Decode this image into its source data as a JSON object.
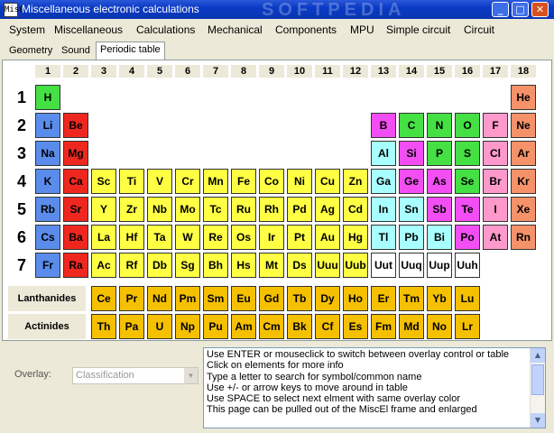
{
  "window": {
    "title": "Miscellaneous electronic calculations",
    "watermark": "SOFTPEDIA",
    "app_icon": "MisC",
    "min_glyph": "_",
    "max_glyph": "□",
    "close_glyph": "✕"
  },
  "menu": [
    "System",
    "Miscellaneous",
    "Calculations",
    "Mechanical",
    "Components",
    "MPU",
    "Simple circuit",
    "Circuit"
  ],
  "tabs": [
    {
      "label": "Geometry",
      "active": false
    },
    {
      "label": "Sound",
      "active": false
    },
    {
      "label": "Periodic table",
      "active": true
    }
  ],
  "colors": {
    "alkali": "#5a8cec",
    "alkaline_earth": "#f0271f",
    "transition": "#ffff44",
    "post_transition": "#a8ffff",
    "metalloid": "#f34ef3",
    "nonmetal": "#44e044",
    "halogen": "#ff99cc",
    "noble_gas": "#f5926a",
    "lanthanide": "#f5c000",
    "actinide": "#f5c000",
    "unknown": "#ffffff"
  },
  "groups": [
    "1",
    "2",
    "3",
    "4",
    "5",
    "6",
    "7",
    "8",
    "9",
    "10",
    "11",
    "12",
    "13",
    "14",
    "15",
    "16",
    "17",
    "18"
  ],
  "periods": [
    "1",
    "2",
    "3",
    "4",
    "5",
    "6",
    "7"
  ],
  "elements": [
    {
      "s": "H",
      "g": 1,
      "p": 1,
      "c": "nonmetal"
    },
    {
      "s": "He",
      "g": 18,
      "p": 1,
      "c": "noble_gas"
    },
    {
      "s": "Li",
      "g": 1,
      "p": 2,
      "c": "alkali"
    },
    {
      "s": "Be",
      "g": 2,
      "p": 2,
      "c": "alkaline_earth"
    },
    {
      "s": "B",
      "g": 13,
      "p": 2,
      "c": "metalloid"
    },
    {
      "s": "C",
      "g": 14,
      "p": 2,
      "c": "nonmetal"
    },
    {
      "s": "N",
      "g": 15,
      "p": 2,
      "c": "nonmetal"
    },
    {
      "s": "O",
      "g": 16,
      "p": 2,
      "c": "nonmetal"
    },
    {
      "s": "F",
      "g": 17,
      "p": 2,
      "c": "halogen"
    },
    {
      "s": "Ne",
      "g": 18,
      "p": 2,
      "c": "noble_gas"
    },
    {
      "s": "Na",
      "g": 1,
      "p": 3,
      "c": "alkali"
    },
    {
      "s": "Mg",
      "g": 2,
      "p": 3,
      "c": "alkaline_earth"
    },
    {
      "s": "Al",
      "g": 13,
      "p": 3,
      "c": "post_transition"
    },
    {
      "s": "Si",
      "g": 14,
      "p": 3,
      "c": "metalloid"
    },
    {
      "s": "P",
      "g": 15,
      "p": 3,
      "c": "nonmetal"
    },
    {
      "s": "S",
      "g": 16,
      "p": 3,
      "c": "nonmetal"
    },
    {
      "s": "Cl",
      "g": 17,
      "p": 3,
      "c": "halogen"
    },
    {
      "s": "Ar",
      "g": 18,
      "p": 3,
      "c": "noble_gas"
    },
    {
      "s": "K",
      "g": 1,
      "p": 4,
      "c": "alkali"
    },
    {
      "s": "Ca",
      "g": 2,
      "p": 4,
      "c": "alkaline_earth"
    },
    {
      "s": "Sc",
      "g": 3,
      "p": 4,
      "c": "transition"
    },
    {
      "s": "Ti",
      "g": 4,
      "p": 4,
      "c": "transition"
    },
    {
      "s": "V",
      "g": 5,
      "p": 4,
      "c": "transition"
    },
    {
      "s": "Cr",
      "g": 6,
      "p": 4,
      "c": "transition"
    },
    {
      "s": "Mn",
      "g": 7,
      "p": 4,
      "c": "transition"
    },
    {
      "s": "Fe",
      "g": 8,
      "p": 4,
      "c": "transition"
    },
    {
      "s": "Co",
      "g": 9,
      "p": 4,
      "c": "transition"
    },
    {
      "s": "Ni",
      "g": 10,
      "p": 4,
      "c": "transition"
    },
    {
      "s": "Cu",
      "g": 11,
      "p": 4,
      "c": "transition"
    },
    {
      "s": "Zn",
      "g": 12,
      "p": 4,
      "c": "transition"
    },
    {
      "s": "Ga",
      "g": 13,
      "p": 4,
      "c": "post_transition"
    },
    {
      "s": "Ge",
      "g": 14,
      "p": 4,
      "c": "metalloid"
    },
    {
      "s": "As",
      "g": 15,
      "p": 4,
      "c": "metalloid"
    },
    {
      "s": "Se",
      "g": 16,
      "p": 4,
      "c": "nonmetal"
    },
    {
      "s": "Br",
      "g": 17,
      "p": 4,
      "c": "halogen"
    },
    {
      "s": "Kr",
      "g": 18,
      "p": 4,
      "c": "noble_gas"
    },
    {
      "s": "Rb",
      "g": 1,
      "p": 5,
      "c": "alkali"
    },
    {
      "s": "Sr",
      "g": 2,
      "p": 5,
      "c": "alkaline_earth"
    },
    {
      "s": "Y",
      "g": 3,
      "p": 5,
      "c": "transition"
    },
    {
      "s": "Zr",
      "g": 4,
      "p": 5,
      "c": "transition"
    },
    {
      "s": "Nb",
      "g": 5,
      "p": 5,
      "c": "transition"
    },
    {
      "s": "Mo",
      "g": 6,
      "p": 5,
      "c": "transition"
    },
    {
      "s": "Tc",
      "g": 7,
      "p": 5,
      "c": "transition"
    },
    {
      "s": "Ru",
      "g": 8,
      "p": 5,
      "c": "transition"
    },
    {
      "s": "Rh",
      "g": 9,
      "p": 5,
      "c": "transition"
    },
    {
      "s": "Pd",
      "g": 10,
      "p": 5,
      "c": "transition"
    },
    {
      "s": "Ag",
      "g": 11,
      "p": 5,
      "c": "transition"
    },
    {
      "s": "Cd",
      "g": 12,
      "p": 5,
      "c": "transition"
    },
    {
      "s": "In",
      "g": 13,
      "p": 5,
      "c": "post_transition"
    },
    {
      "s": "Sn",
      "g": 14,
      "p": 5,
      "c": "post_transition"
    },
    {
      "s": "Sb",
      "g": 15,
      "p": 5,
      "c": "metalloid"
    },
    {
      "s": "Te",
      "g": 16,
      "p": 5,
      "c": "metalloid"
    },
    {
      "s": "I",
      "g": 17,
      "p": 5,
      "c": "halogen"
    },
    {
      "s": "Xe",
      "g": 18,
      "p": 5,
      "c": "noble_gas"
    },
    {
      "s": "Cs",
      "g": 1,
      "p": 6,
      "c": "alkali"
    },
    {
      "s": "Ba",
      "g": 2,
      "p": 6,
      "c": "alkaline_earth"
    },
    {
      "s": "La",
      "g": 3,
      "p": 6,
      "c": "transition"
    },
    {
      "s": "Hf",
      "g": 4,
      "p": 6,
      "c": "transition"
    },
    {
      "s": "Ta",
      "g": 5,
      "p": 6,
      "c": "transition"
    },
    {
      "s": "W",
      "g": 6,
      "p": 6,
      "c": "transition"
    },
    {
      "s": "Re",
      "g": 7,
      "p": 6,
      "c": "transition"
    },
    {
      "s": "Os",
      "g": 8,
      "p": 6,
      "c": "transition"
    },
    {
      "s": "Ir",
      "g": 9,
      "p": 6,
      "c": "transition"
    },
    {
      "s": "Pt",
      "g": 10,
      "p": 6,
      "c": "transition"
    },
    {
      "s": "Au",
      "g": 11,
      "p": 6,
      "c": "transition"
    },
    {
      "s": "Hg",
      "g": 12,
      "p": 6,
      "c": "transition"
    },
    {
      "s": "Tl",
      "g": 13,
      "p": 6,
      "c": "post_transition"
    },
    {
      "s": "Pb",
      "g": 14,
      "p": 6,
      "c": "post_transition"
    },
    {
      "s": "Bi",
      "g": 15,
      "p": 6,
      "c": "post_transition"
    },
    {
      "s": "Po",
      "g": 16,
      "p": 6,
      "c": "metalloid"
    },
    {
      "s": "At",
      "g": 17,
      "p": 6,
      "c": "halogen"
    },
    {
      "s": "Rn",
      "g": 18,
      "p": 6,
      "c": "noble_gas"
    },
    {
      "s": "Fr",
      "g": 1,
      "p": 7,
      "c": "alkali"
    },
    {
      "s": "Ra",
      "g": 2,
      "p": 7,
      "c": "alkaline_earth"
    },
    {
      "s": "Ac",
      "g": 3,
      "p": 7,
      "c": "transition"
    },
    {
      "s": "Rf",
      "g": 4,
      "p": 7,
      "c": "transition"
    },
    {
      "s": "Db",
      "g": 5,
      "p": 7,
      "c": "transition"
    },
    {
      "s": "Sg",
      "g": 6,
      "p": 7,
      "c": "transition"
    },
    {
      "s": "Bh",
      "g": 7,
      "p": 7,
      "c": "transition"
    },
    {
      "s": "Hs",
      "g": 8,
      "p": 7,
      "c": "transition"
    },
    {
      "s": "Mt",
      "g": 9,
      "p": 7,
      "c": "transition"
    },
    {
      "s": "Ds",
      "g": 10,
      "p": 7,
      "c": "transition"
    },
    {
      "s": "Uuu",
      "g": 11,
      "p": 7,
      "c": "transition"
    },
    {
      "s": "Uub",
      "g": 12,
      "p": 7,
      "c": "transition"
    },
    {
      "s": "Uut",
      "g": 13,
      "p": 7,
      "c": "unknown"
    },
    {
      "s": "Uuq",
      "g": 14,
      "p": 7,
      "c": "unknown"
    },
    {
      "s": "Uup",
      "g": 15,
      "p": 7,
      "c": "unknown"
    },
    {
      "s": "Uuh",
      "g": 16,
      "p": 7,
      "c": "unknown"
    }
  ],
  "series": [
    {
      "label": "Lanthanides",
      "c": "lanthanide",
      "elements": [
        "Ce",
        "Pr",
        "Nd",
        "Pm",
        "Sm",
        "Eu",
        "Gd",
        "Tb",
        "Dy",
        "Ho",
        "Er",
        "Tm",
        "Yb",
        "Lu"
      ]
    },
    {
      "label": "Actinides",
      "c": "actinide",
      "elements": [
        "Th",
        "Pa",
        "U",
        "Np",
        "Pu",
        "Am",
        "Cm",
        "Bk",
        "Cf",
        "Es",
        "Fm",
        "Md",
        "No",
        "Lr"
      ]
    }
  ],
  "overlay": {
    "label": "Overlay:",
    "value": "Classification"
  },
  "info_lines": [
    "Use ENTER or mouseclick to switch between overlay control or table",
    "Click on elements for more info",
    "Type a letter to search for symbol/common name",
    "Use +/- or arrow keys to move around in table",
    "Use SPACE to select next elment with same overlay color",
    "This page can be pulled out of the MiscEl frame and enlarged"
  ]
}
